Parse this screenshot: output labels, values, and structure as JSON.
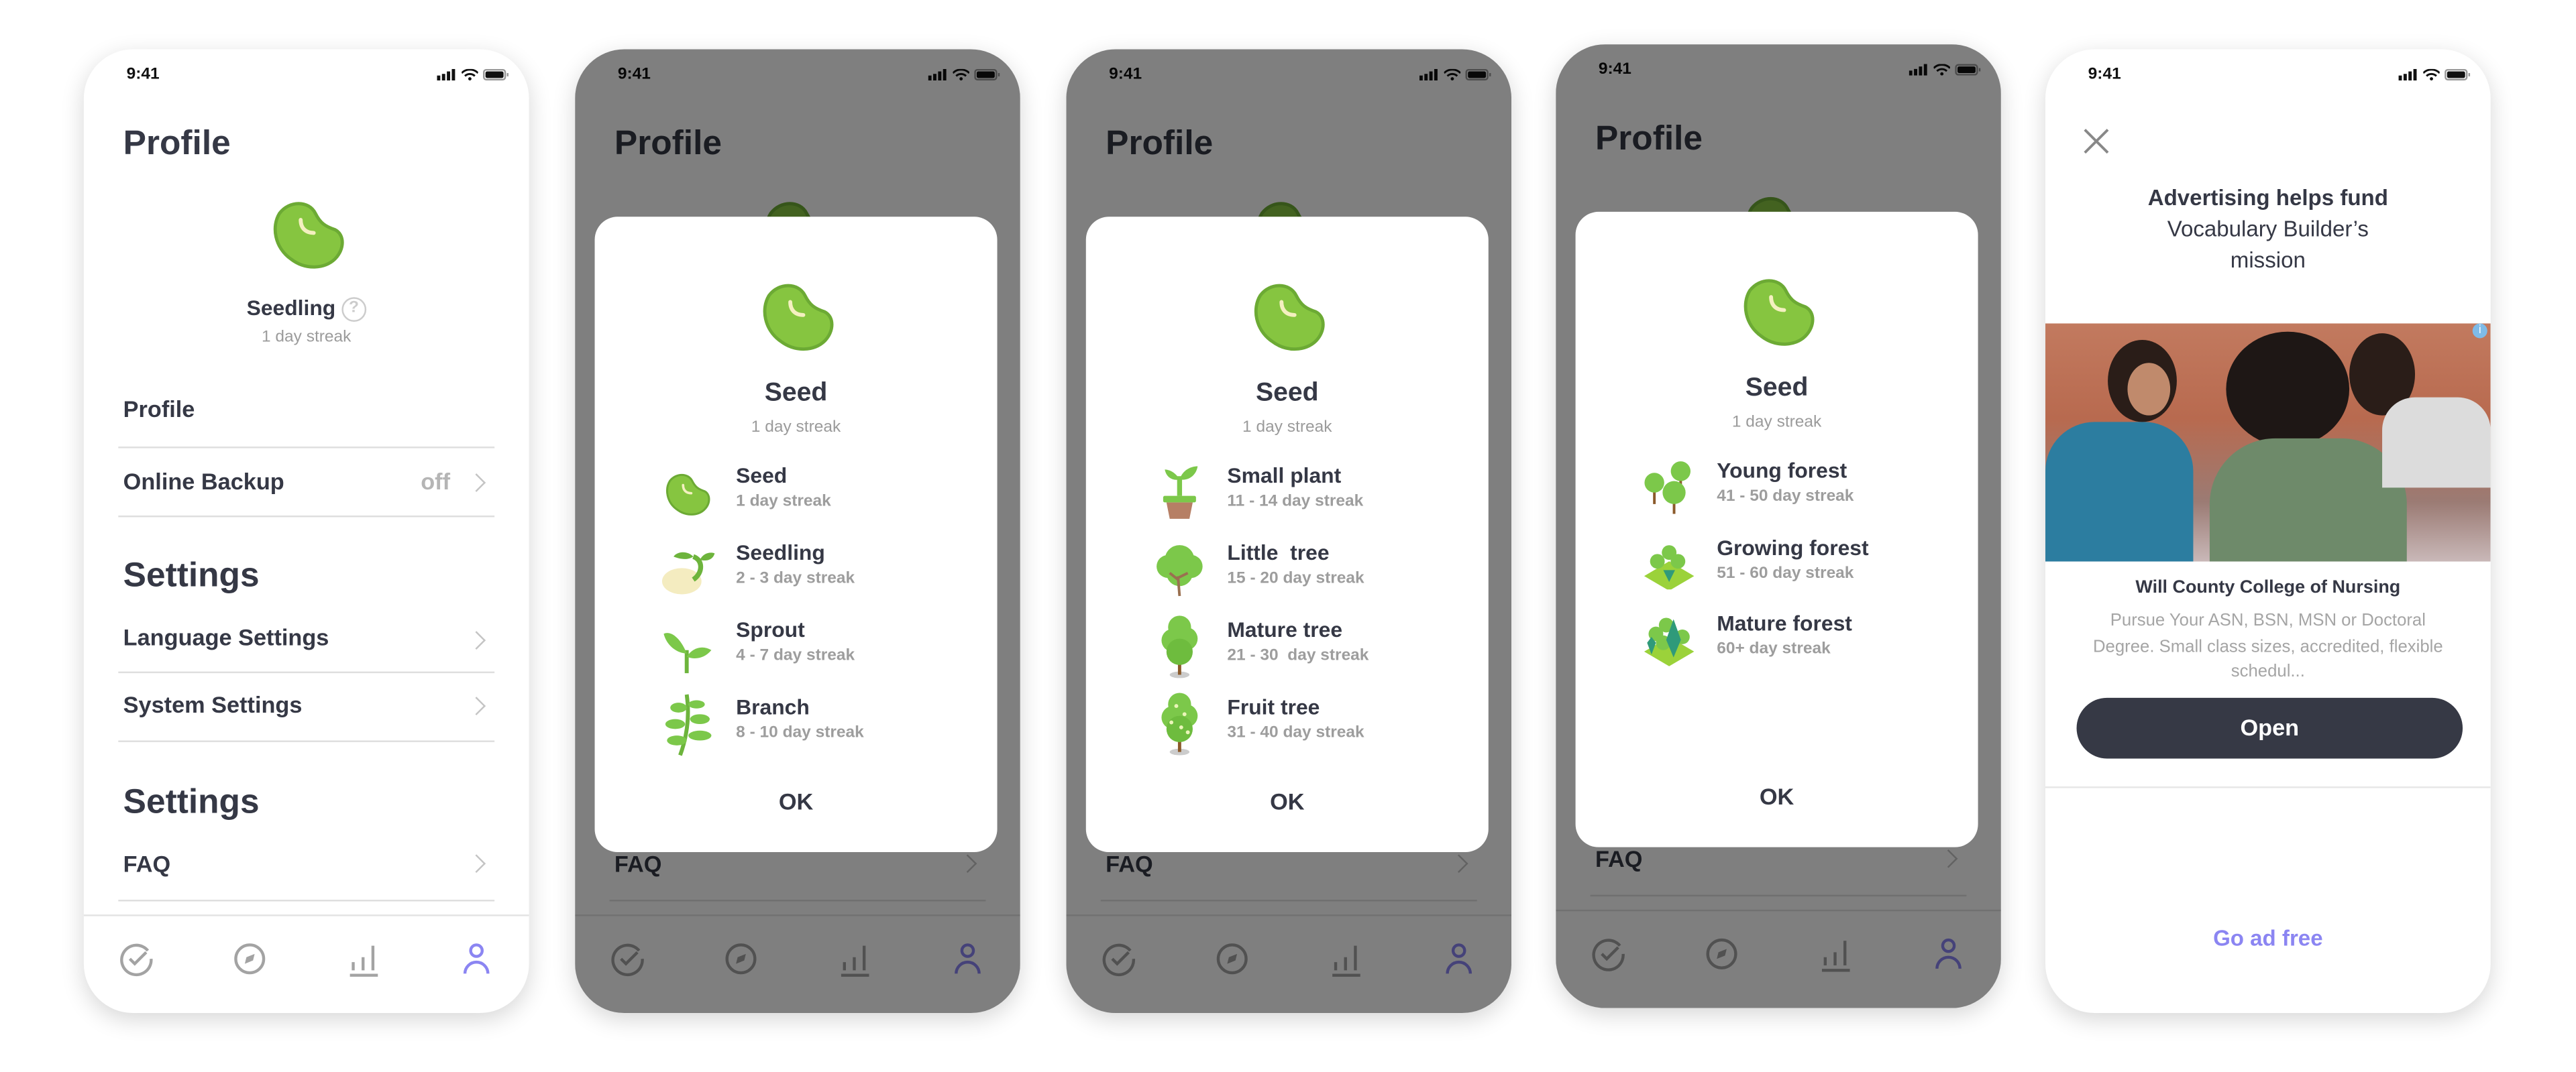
{
  "status": {
    "time": "9:41"
  },
  "profile": {
    "title": "Profile",
    "level": "Seedling",
    "streak": "1 day streak",
    "help_icon": "question-circle-icon",
    "rows": {
      "profile": "Profile",
      "backup": "Online Backup",
      "backup_value": "off",
      "settings1": "Settings",
      "language": "Language Settings",
      "system": "System Settings",
      "settings2": "Settings",
      "faq": "FAQ"
    },
    "tabs": [
      "check-circle-icon",
      "compass-icon",
      "bar-chart-icon",
      "person-icon"
    ],
    "active_tab_color": "#8b85f2"
  },
  "dialogs": [
    {
      "title": "Seed",
      "streak": "1 day streak",
      "ok": "OK",
      "items": [
        {
          "name": "Seed",
          "range": "1 day streak",
          "icon": "seed-icon"
        },
        {
          "name": "Seedling",
          "range": "2 - 3 day streak",
          "icon": "seedling-icon"
        },
        {
          "name": "Sprout",
          "range": "4 - 7 day streak",
          "icon": "sprout-icon"
        },
        {
          "name": "Branch",
          "range": "8 - 10 day streak",
          "icon": "branch-icon"
        }
      ]
    },
    {
      "title": "Seed",
      "streak": "1 day streak",
      "ok": "OK",
      "items": [
        {
          "name": "Small plant",
          "range": "11 - 14 day streak",
          "icon": "potted-plant-icon"
        },
        {
          "name": "Little  tree",
          "range": "15 - 20 day streak",
          "icon": "little-tree-icon"
        },
        {
          "name": "Mature tree",
          "range": "21 - 30  day streak",
          "icon": "mature-tree-icon"
        },
        {
          "name": "Fruit tree",
          "range": "31 - 40 day streak",
          "icon": "fruit-tree-icon"
        }
      ]
    },
    {
      "title": "Seed",
      "streak": "1 day streak",
      "ok": "OK",
      "items": [
        {
          "name": "Young forest",
          "range": "41 - 50 day streak",
          "icon": "young-forest-icon"
        },
        {
          "name": "Growing forest",
          "range": "51 - 60 day streak",
          "icon": "growing-forest-icon"
        },
        {
          "name": "Mature forest",
          "range": "60+ day streak",
          "icon": "mature-forest-icon"
        }
      ]
    }
  ],
  "ad": {
    "headline_bold": "Advertising helps fund",
    "headline_line2": "Vocabulary Builder’s",
    "headline_line3": "mission",
    "advertiser": "Will County College of Nursing",
    "description": "Pursue Your ASN, BSN, MSN or Doctoral Degree. Small class sizes, accredited, flexible schedul...",
    "cta": "Open",
    "go_ad_free": "Go ad free",
    "accent": "#8b85f2",
    "button_color": "#363945"
  }
}
